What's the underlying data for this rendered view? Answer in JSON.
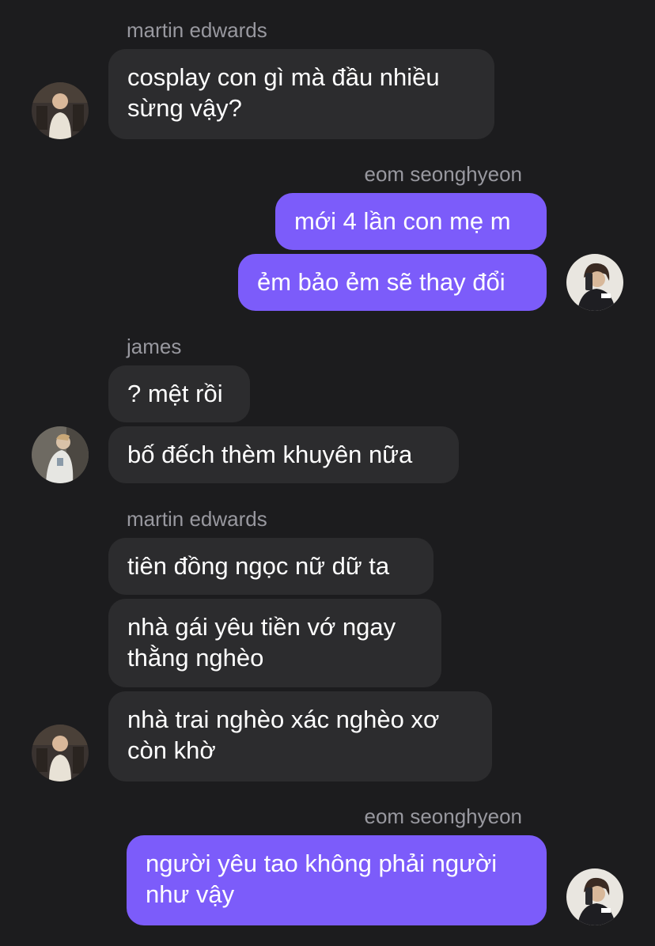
{
  "messages": [
    {
      "sender": "martin edwards",
      "text": "cosplay con gì mà đầu nhiều\nsừng vậy?"
    },
    {
      "sender": "eom seonghyeon",
      "text": "mới 4 lần con mẹ m"
    },
    {
      "sender": "eom seonghyeon",
      "text": "ẻm bảo ẻm sẽ thay đổi"
    },
    {
      "sender": "james",
      "text": "? mệt rồi"
    },
    {
      "sender": "james",
      "text": "bố đếch thèm khuyên nữa"
    },
    {
      "sender": "martin edwards",
      "text": "tiên đồng ngọc nữ dữ ta"
    },
    {
      "sender": "martin edwards",
      "text": "nhà gái yêu tiền vớ ngay\nthằng nghèo"
    },
    {
      "sender": "martin edwards",
      "text": "nhà trai nghèo xác nghèo xơ\ncòn khờ"
    },
    {
      "sender": "eom seonghyeon",
      "text": "người yêu tao không phải người\nnhư vậy"
    }
  ],
  "colors": {
    "background": "#1c1c1e",
    "incoming_bubble": "#2c2c2e",
    "outgoing_bubble": "#7c5cfa",
    "sender_name": "#98989f"
  }
}
